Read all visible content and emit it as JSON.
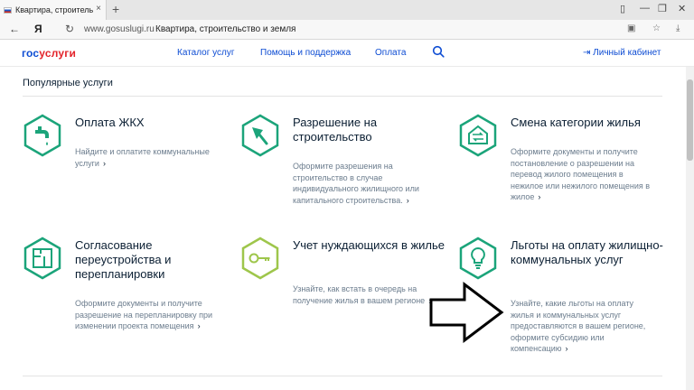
{
  "browser": {
    "tab_title": "Квартира, строительство и земля",
    "new_tab": "+",
    "close": "×",
    "back": "←",
    "yandex": "Я",
    "reload": "↻",
    "domain": "www.gosuslugi.ru",
    "page_title": "Квартира, строительство и земля",
    "win_min": "—",
    "win_max": "❐",
    "win_close": "✕",
    "download": "⤓",
    "bookmark": "☆",
    "menu": "≡"
  },
  "header": {
    "logo_gos": "гос",
    "logo_uslugi": "услуги",
    "nav": [
      "Каталог услуг",
      "Помощь и поддержка",
      "Оплата"
    ],
    "cabinet": "Личный кабинет"
  },
  "section_title": "Популярные услуги",
  "cards": [
    {
      "title": "Оплата ЖКХ",
      "desc": "Найдите и оплатите коммунальные услуги",
      "icon": "faucet-icon"
    },
    {
      "title": "Разрешение на строительство",
      "desc": "Оформите разрешения на строительство в случае индивидуального жилищного или капитального строительства.",
      "icon": "trowel-icon"
    },
    {
      "title": "Смена категории жилья",
      "desc": "Оформите документы и получите постановление о разрешении на перевод жилого помещения в нежилое или нежилого помещения в жилое",
      "icon": "house-arrows-icon"
    },
    {
      "title": "Согласование переустройства и перепланировки",
      "desc": "Оформите документы и получите разрешение на перепланировку при изменении проекта помещения",
      "icon": "floorplan-icon"
    },
    {
      "title": "Учет нуждающихся в жилье",
      "desc": "Узнайте, как встать в очередь на получение жилья в вашем регионе",
      "icon": "key-icon"
    },
    {
      "title": "Льготы на оплату жилищно-коммунальных услуг",
      "desc": "Узнайте, какие льготы на оплату жилья и коммунальных услуг предоставляются в вашем регионе, оформите субсидию или компенсацию",
      "icon": "lightbulb-icon"
    }
  ],
  "colors": {
    "brand_blue": "#0d4cd3",
    "brand_red": "#e3232a",
    "icon_green": "#1ba47a"
  }
}
